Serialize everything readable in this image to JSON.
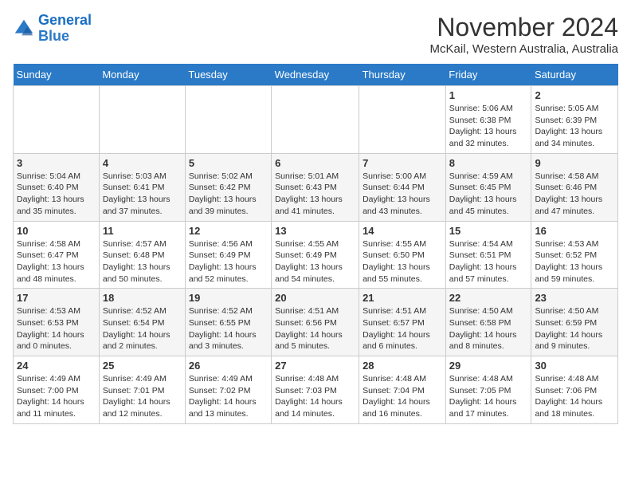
{
  "logo": {
    "line1": "General",
    "line2": "Blue"
  },
  "title": "November 2024",
  "location": "McKail, Western Australia, Australia",
  "days_of_week": [
    "Sunday",
    "Monday",
    "Tuesday",
    "Wednesday",
    "Thursday",
    "Friday",
    "Saturday"
  ],
  "weeks": [
    [
      {
        "day": "",
        "info": ""
      },
      {
        "day": "",
        "info": ""
      },
      {
        "day": "",
        "info": ""
      },
      {
        "day": "",
        "info": ""
      },
      {
        "day": "",
        "info": ""
      },
      {
        "day": "1",
        "info": "Sunrise: 5:06 AM\nSunset: 6:38 PM\nDaylight: 13 hours\nand 32 minutes."
      },
      {
        "day": "2",
        "info": "Sunrise: 5:05 AM\nSunset: 6:39 PM\nDaylight: 13 hours\nand 34 minutes."
      }
    ],
    [
      {
        "day": "3",
        "info": "Sunrise: 5:04 AM\nSunset: 6:40 PM\nDaylight: 13 hours\nand 35 minutes."
      },
      {
        "day": "4",
        "info": "Sunrise: 5:03 AM\nSunset: 6:41 PM\nDaylight: 13 hours\nand 37 minutes."
      },
      {
        "day": "5",
        "info": "Sunrise: 5:02 AM\nSunset: 6:42 PM\nDaylight: 13 hours\nand 39 minutes."
      },
      {
        "day": "6",
        "info": "Sunrise: 5:01 AM\nSunset: 6:43 PM\nDaylight: 13 hours\nand 41 minutes."
      },
      {
        "day": "7",
        "info": "Sunrise: 5:00 AM\nSunset: 6:44 PM\nDaylight: 13 hours\nand 43 minutes."
      },
      {
        "day": "8",
        "info": "Sunrise: 4:59 AM\nSunset: 6:45 PM\nDaylight: 13 hours\nand 45 minutes."
      },
      {
        "day": "9",
        "info": "Sunrise: 4:58 AM\nSunset: 6:46 PM\nDaylight: 13 hours\nand 47 minutes."
      }
    ],
    [
      {
        "day": "10",
        "info": "Sunrise: 4:58 AM\nSunset: 6:47 PM\nDaylight: 13 hours\nand 48 minutes."
      },
      {
        "day": "11",
        "info": "Sunrise: 4:57 AM\nSunset: 6:48 PM\nDaylight: 13 hours\nand 50 minutes."
      },
      {
        "day": "12",
        "info": "Sunrise: 4:56 AM\nSunset: 6:49 PM\nDaylight: 13 hours\nand 52 minutes."
      },
      {
        "day": "13",
        "info": "Sunrise: 4:55 AM\nSunset: 6:49 PM\nDaylight: 13 hours\nand 54 minutes."
      },
      {
        "day": "14",
        "info": "Sunrise: 4:55 AM\nSunset: 6:50 PM\nDaylight: 13 hours\nand 55 minutes."
      },
      {
        "day": "15",
        "info": "Sunrise: 4:54 AM\nSunset: 6:51 PM\nDaylight: 13 hours\nand 57 minutes."
      },
      {
        "day": "16",
        "info": "Sunrise: 4:53 AM\nSunset: 6:52 PM\nDaylight: 13 hours\nand 59 minutes."
      }
    ],
    [
      {
        "day": "17",
        "info": "Sunrise: 4:53 AM\nSunset: 6:53 PM\nDaylight: 14 hours\nand 0 minutes."
      },
      {
        "day": "18",
        "info": "Sunrise: 4:52 AM\nSunset: 6:54 PM\nDaylight: 14 hours\nand 2 minutes."
      },
      {
        "day": "19",
        "info": "Sunrise: 4:52 AM\nSunset: 6:55 PM\nDaylight: 14 hours\nand 3 minutes."
      },
      {
        "day": "20",
        "info": "Sunrise: 4:51 AM\nSunset: 6:56 PM\nDaylight: 14 hours\nand 5 minutes."
      },
      {
        "day": "21",
        "info": "Sunrise: 4:51 AM\nSunset: 6:57 PM\nDaylight: 14 hours\nand 6 minutes."
      },
      {
        "day": "22",
        "info": "Sunrise: 4:50 AM\nSunset: 6:58 PM\nDaylight: 14 hours\nand 8 minutes."
      },
      {
        "day": "23",
        "info": "Sunrise: 4:50 AM\nSunset: 6:59 PM\nDaylight: 14 hours\nand 9 minutes."
      }
    ],
    [
      {
        "day": "24",
        "info": "Sunrise: 4:49 AM\nSunset: 7:00 PM\nDaylight: 14 hours\nand 11 minutes."
      },
      {
        "day": "25",
        "info": "Sunrise: 4:49 AM\nSunset: 7:01 PM\nDaylight: 14 hours\nand 12 minutes."
      },
      {
        "day": "26",
        "info": "Sunrise: 4:49 AM\nSunset: 7:02 PM\nDaylight: 14 hours\nand 13 minutes."
      },
      {
        "day": "27",
        "info": "Sunrise: 4:48 AM\nSunset: 7:03 PM\nDaylight: 14 hours\nand 14 minutes."
      },
      {
        "day": "28",
        "info": "Sunrise: 4:48 AM\nSunset: 7:04 PM\nDaylight: 14 hours\nand 16 minutes."
      },
      {
        "day": "29",
        "info": "Sunrise: 4:48 AM\nSunset: 7:05 PM\nDaylight: 14 hours\nand 17 minutes."
      },
      {
        "day": "30",
        "info": "Sunrise: 4:48 AM\nSunset: 7:06 PM\nDaylight: 14 hours\nand 18 minutes."
      }
    ]
  ]
}
